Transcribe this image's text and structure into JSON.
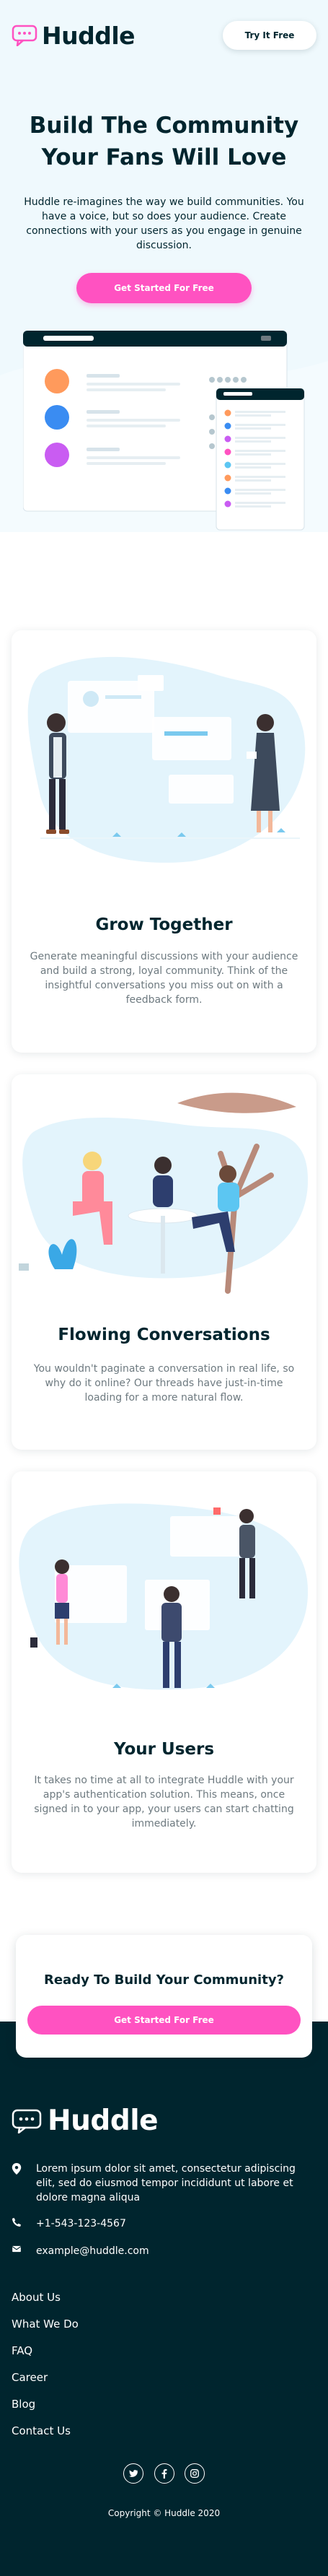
{
  "brand": {
    "name": "Huddle",
    "accent": "#ff52c1",
    "dark": "#00252e",
    "light_bg": "#eff9fd"
  },
  "header": {
    "try_label": "Try It Free"
  },
  "hero": {
    "title_line1": "Build The Community",
    "title_line2": "Your Fans Will Love",
    "description": "Huddle re-imagines the way we build communities. You have a voice, but so does your audience. Create connections with your users as you engage in genuine discussion.",
    "cta_label": "Get Started For Free"
  },
  "features": [
    {
      "title": "Grow Together",
      "description": "Generate meaningful discussions with your audience and build a strong, loyal community. Think of the insightful conversations you miss out on with a feedback form."
    },
    {
      "title": "Flowing Conversations",
      "description": "You wouldn't paginate a conversation in real life, so why do it online? Our threads have just-in-time loading for a more natural flow."
    },
    {
      "title": "Your Users",
      "description": "It takes no time at all to integrate Huddle with your app's authentication solution. This means, once signed in to your app, your users can start chatting immediately."
    }
  ],
  "cta_card": {
    "title": "Ready To Build Your Community?",
    "button_label": "Get Started For Free"
  },
  "footer": {
    "address": "Lorem ipsum dolor sit amet, consectetur adipiscing elit, sed do eiusmod tempor incididunt ut labore et dolore magna aliqua",
    "phone": "+1-543-123-4567",
    "email": "example@huddle.com",
    "links": [
      "About Us",
      "What We Do",
      "FAQ",
      "Career",
      "Blog",
      "Contact Us"
    ],
    "socials": [
      "twitter-icon",
      "facebook-icon",
      "instagram-icon"
    ],
    "copyright": "Copyright © Huddle 2020"
  }
}
